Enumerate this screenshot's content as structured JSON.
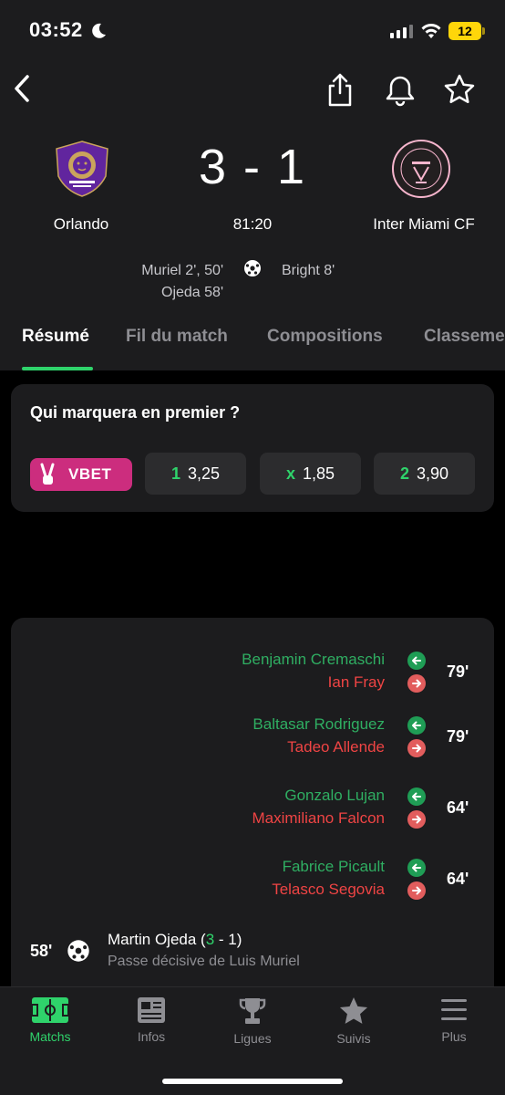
{
  "status_bar": {
    "time": "03:52",
    "battery": "12"
  },
  "match": {
    "home_team": "Orlando",
    "away_team": "Inter Miami CF",
    "score": "3 - 1",
    "clock": "81:20",
    "home_scorers": [
      "Muriel 2', 50'",
      "Ojeda 58'"
    ],
    "away_scorers": [
      "Bright 8'"
    ]
  },
  "tabs": [
    "Résumé",
    "Fil du match",
    "Compositions",
    "Classement"
  ],
  "odds": {
    "title": "Qui marquera en premier ?",
    "bookmaker": "VBET",
    "options": [
      {
        "key": "1",
        "value": "3,25"
      },
      {
        "key": "x",
        "value": "1,85"
      },
      {
        "key": "2",
        "value": "3,90"
      }
    ]
  },
  "substitutions": [
    {
      "in": "Benjamin Cremaschi",
      "out": "Ian Fray",
      "minute": "79'"
    },
    {
      "in": "Baltasar Rodriguez",
      "out": "Tadeo Allende",
      "minute": "79'"
    },
    {
      "in": "Gonzalo Lujan",
      "out": "Maximiliano Falcon",
      "minute": "64'"
    },
    {
      "in": "Fabrice Picault",
      "out": "Telasco Segovia",
      "minute": "64'"
    }
  ],
  "goal_event": {
    "minute": "58'",
    "player": "Martin Ojeda (",
    "home_goals": "3",
    "score_rest": " - 1)",
    "assist": "Passe décisive de Luis Muriel"
  },
  "bottom_nav": [
    "Matchs",
    "Infos",
    "Ligues",
    "Suivis",
    "Plus"
  ],
  "colors": {
    "accent": "#2fd36b",
    "sub_in": "#2fae62",
    "sub_out": "#ef4444",
    "vbet": "#cc2d7e",
    "home_brand": "#61259e"
  }
}
